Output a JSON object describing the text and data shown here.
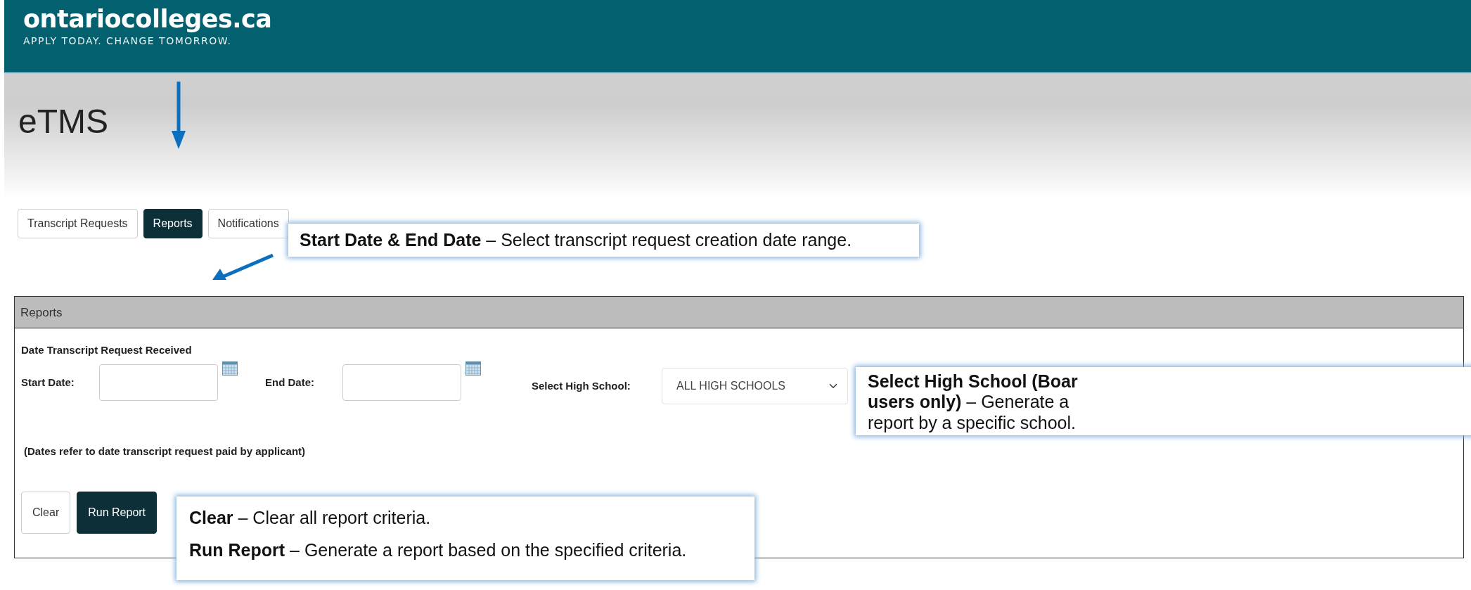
{
  "header": {
    "logo": "ontariocolleges.ca",
    "tagline": "APPLY TODAY. CHANGE TOMORROW."
  },
  "page_title": "eTMS",
  "tabs": [
    {
      "label": "Transcript Requests",
      "selected": false
    },
    {
      "label": "Reports",
      "selected": true
    },
    {
      "label": "Notifications",
      "selected": false
    }
  ],
  "panel": {
    "title": "Reports",
    "section_label": "Date Transcript Request Received",
    "start_date": {
      "label": "Start Date:"
    },
    "end_date": {
      "label": "End Date:"
    },
    "high_school": {
      "label": "Select High School:",
      "value": "ALL HIGH SCHOOLS"
    },
    "note": "(Dates refer to date transcript request paid by applicant)",
    "buttons": [
      {
        "label": "Clear",
        "kind": "secondary"
      },
      {
        "label": "Run Report",
        "kind": "primary"
      }
    ]
  },
  "callouts": [
    {
      "lines": [
        "**Start Date & End Date** – Select transcript request creation date range."
      ]
    },
    {
      "lines": [
        "**Select High School (Boar**",
        "**users only)** – Generate a",
        "report by a specific school."
      ]
    },
    {
      "lines": [
        "**Clear** – Clear all report criteria.",
        "**Run Report** – Generate a report based on the specified criteria."
      ]
    }
  ]
}
